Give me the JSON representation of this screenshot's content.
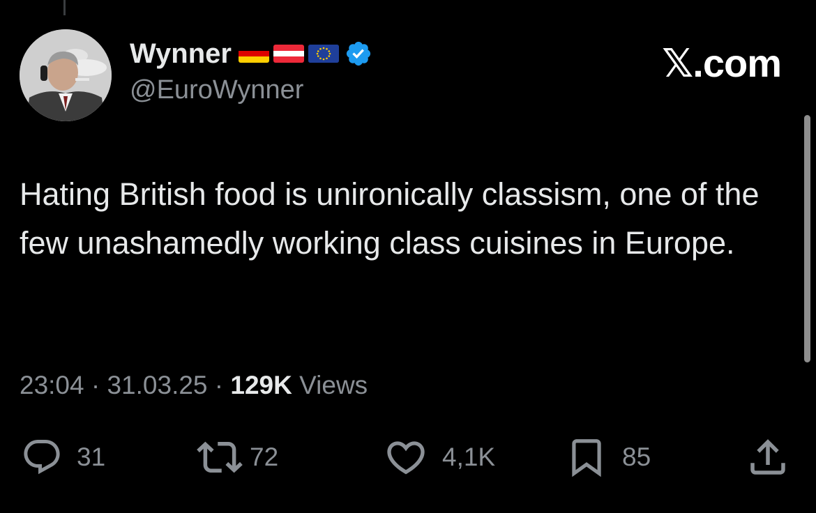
{
  "author": {
    "display_name": "Wynner",
    "handle": "@EuroWynner",
    "flags": [
      "germany-flag",
      "austria-flag",
      "eu-flag"
    ],
    "verified_icon": "verified-badge-icon",
    "avatar_icon": "profile-avatar"
  },
  "brand": {
    "label": "𝕏.com"
  },
  "tweet": {
    "text": "Hating British food is unironically classism, one of the few unashamedly working class cuisines in Europe."
  },
  "meta": {
    "time": "23:04",
    "separator": " · ",
    "date": "31.03.25",
    "views_count": "129K",
    "views_label": " Views"
  },
  "actions": {
    "replies": {
      "icon": "reply-icon",
      "count": "31"
    },
    "reposts": {
      "icon": "repost-icon",
      "count": "72"
    },
    "likes": {
      "icon": "heart-icon",
      "count": "4,1K"
    },
    "bookmarks": {
      "icon": "bookmark-icon",
      "count": "85"
    },
    "share": {
      "icon": "share-icon"
    }
  },
  "colors": {
    "background": "#000000",
    "text": "#e7e9ea",
    "secondary_text": "#8b9096",
    "verified_blue": "#1d9bf0"
  }
}
